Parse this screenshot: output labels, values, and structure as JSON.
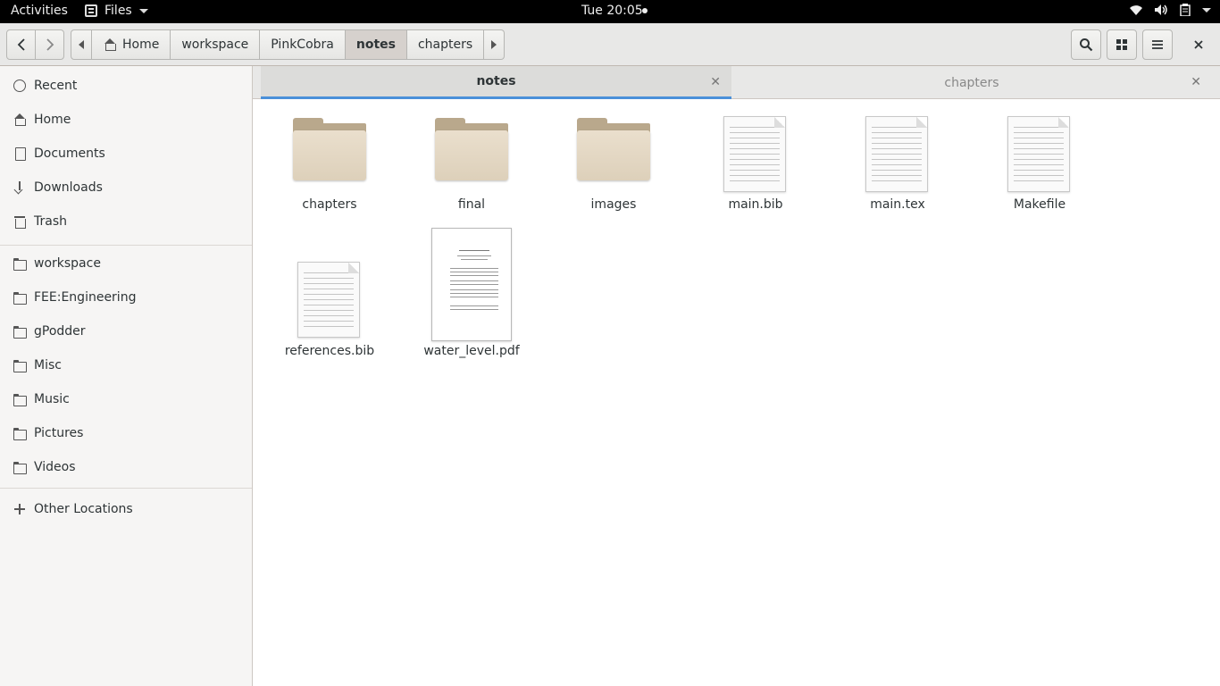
{
  "topbar": {
    "activities": "Activities",
    "app_name": "Files",
    "clock": "Tue 20:05",
    "tray_icons": [
      "wifi-icon",
      "volume-icon",
      "clipboard-icon",
      "system-menu-caret"
    ]
  },
  "header": {
    "path": [
      "Home",
      "workspace",
      "PinkCobra",
      "notes",
      "chapters"
    ],
    "active_path": "notes",
    "buttons": [
      "back-icon",
      "forward-icon",
      "path-left-icon",
      "path-right-icon",
      "search-icon",
      "grid-view-icon",
      "menu-icon",
      "close-icon"
    ]
  },
  "sidebar": {
    "places": [
      {
        "label": "Recent",
        "icon": "clock-icon"
      },
      {
        "label": "Home",
        "icon": "home-icon"
      },
      {
        "label": "Documents",
        "icon": "document-icon"
      },
      {
        "label": "Downloads",
        "icon": "download-icon"
      },
      {
        "label": "Trash",
        "icon": "trash-icon"
      }
    ],
    "bookmarks": [
      {
        "label": "workspace"
      },
      {
        "label": "FEE:Engineering"
      },
      {
        "label": "gPodder"
      },
      {
        "label": "Misc"
      },
      {
        "label": "Music"
      },
      {
        "label": "Pictures"
      },
      {
        "label": "Videos"
      }
    ],
    "other": "Other Locations"
  },
  "tabs": [
    {
      "label": "notes",
      "active": true
    },
    {
      "label": "chapters",
      "active": false
    }
  ],
  "files": [
    {
      "name": "chapters",
      "type": "folder"
    },
    {
      "name": "final",
      "type": "folder"
    },
    {
      "name": "images",
      "type": "folder"
    },
    {
      "name": "main.bib",
      "type": "text"
    },
    {
      "name": "main.tex",
      "type": "text"
    },
    {
      "name": "Makefile",
      "type": "text"
    },
    {
      "name": "references.bib",
      "type": "text"
    },
    {
      "name": "water_level.pdf",
      "type": "pdf"
    }
  ],
  "colors": {
    "accent": "#4a90d9",
    "folder": "#eadfcd"
  }
}
